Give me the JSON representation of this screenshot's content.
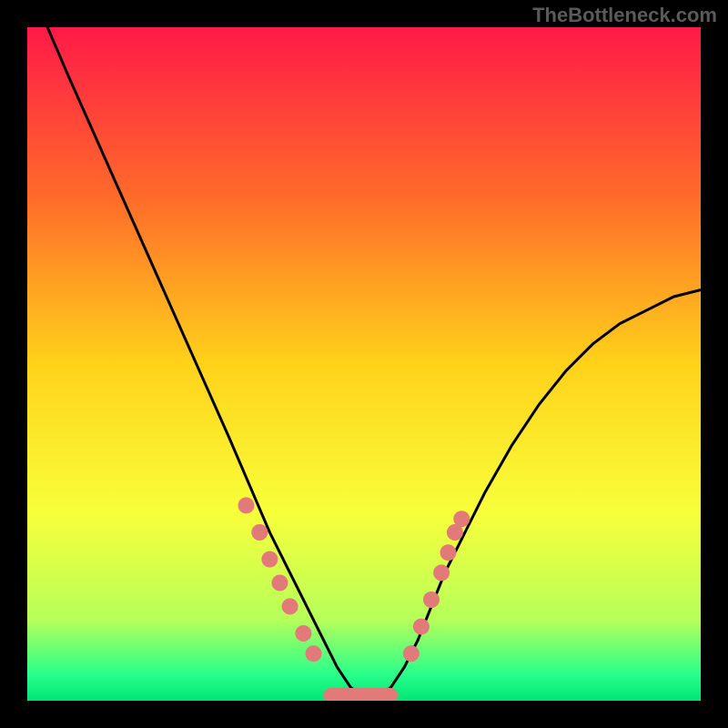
{
  "watermark": "TheBottleneck.com",
  "chart_data": {
    "type": "line",
    "title": "",
    "xlabel": "",
    "ylabel": "",
    "xlim": [
      0,
      100
    ],
    "ylim": [
      0,
      100
    ],
    "background_gradient": {
      "type": "vertical",
      "stops": [
        {
          "offset": 0,
          "color": "#ff1a48"
        },
        {
          "offset": 25,
          "color": "#ff6a2a"
        },
        {
          "offset": 50,
          "color": "#ffd21a"
        },
        {
          "offset": 72,
          "color": "#f8ff3a"
        },
        {
          "offset": 88,
          "color": "#b6ff5a"
        },
        {
          "offset": 96,
          "color": "#2aff8a"
        },
        {
          "offset": 100,
          "color": "#00e676"
        }
      ]
    },
    "series": [
      {
        "name": "bottleneck-curve",
        "type": "line",
        "color": "#000000",
        "x": [
          3,
          6,
          10,
          14,
          18,
          22,
          26,
          30,
          33,
          36,
          39,
          42,
          44,
          46,
          48,
          50,
          52,
          54,
          56,
          58,
          60,
          62,
          65,
          68,
          72,
          76,
          80,
          84,
          88,
          92,
          96,
          100
        ],
        "y": [
          100,
          93,
          84,
          75,
          66,
          57,
          48,
          39,
          32,
          25,
          19,
          13,
          9,
          5,
          2,
          0.5,
          0.5,
          2,
          5,
          9,
          14,
          19,
          25,
          31,
          38,
          44,
          49,
          53,
          56,
          58,
          60,
          61
        ]
      },
      {
        "name": "data-points-left",
        "type": "scatter",
        "color": "#e27a7a",
        "x": [
          32.5,
          34.5,
          36,
          37.5,
          39,
          41,
          42.5
        ],
        "y": [
          29,
          25,
          21,
          17.5,
          14,
          10,
          7
        ]
      },
      {
        "name": "data-points-right",
        "type": "scatter",
        "color": "#e27a7a",
        "x": [
          57,
          58.5,
          60,
          61.5,
          62.5,
          63.5,
          64.5
        ],
        "y": [
          7,
          11,
          15,
          19,
          22,
          25,
          27
        ]
      },
      {
        "name": "bottom-band",
        "type": "bar-segment",
        "color": "#e27a7a",
        "x_start": 44,
        "x_end": 55,
        "y": 0.8,
        "height": 2.2
      }
    ]
  }
}
